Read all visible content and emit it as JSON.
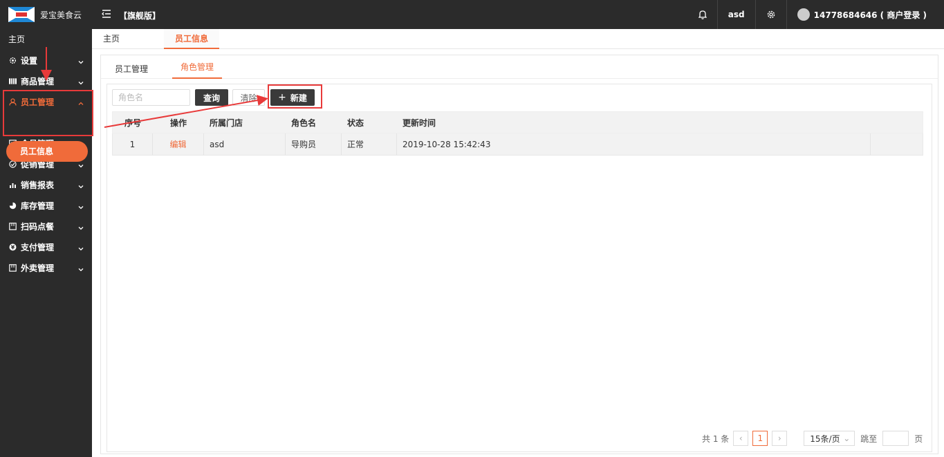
{
  "header": {
    "brand": "爱宝美食云",
    "edition": "【旗舰版】",
    "username": "asd",
    "account": "14778684646 ( 商户登录 )"
  },
  "sidebar": {
    "home": "主页",
    "items": [
      {
        "label": "设置",
        "icon": "gear-icon"
      },
      {
        "label": "商品管理",
        "icon": "barcode-icon"
      },
      {
        "label": "员工管理",
        "icon": "user-icon"
      },
      {
        "label": "会员管理",
        "icon": "member-card-icon"
      },
      {
        "label": "促销管理",
        "icon": "check-circle-icon"
      },
      {
        "label": "销售报表",
        "icon": "bar-chart-icon"
      },
      {
        "label": "库存管理",
        "icon": "pie-chart-icon"
      },
      {
        "label": "扫码点餐",
        "icon": "store-icon"
      },
      {
        "label": "支付管理",
        "icon": "yuan-coin-icon"
      },
      {
        "label": "外卖管理",
        "icon": "store-icon"
      }
    ],
    "active_sub": "员工信息"
  },
  "top_tabs": {
    "home": "主页",
    "active": "员工信息"
  },
  "sub_tabs": {
    "staff": "员工管理",
    "roles": "角色管理"
  },
  "toolbar": {
    "search_placeholder": "角色名",
    "query_label": "查询",
    "clear_label": "清除",
    "new_label": "新建"
  },
  "table": {
    "headers": [
      "序号",
      "操作",
      "所属门店",
      "角色名",
      "状态",
      "更新时间"
    ],
    "rows": [
      {
        "index": "1",
        "action": "编辑",
        "store": "asd",
        "role": "导购员",
        "status": "正常",
        "updated": "2019-10-28 15:42:43"
      }
    ]
  },
  "pager": {
    "total": "共 1 条",
    "current": "1",
    "page_size": "15条/页",
    "jump_label": "跳至",
    "page_unit": "页"
  },
  "colors": {
    "accent": "#f06b3a",
    "dark": "#2b2b2b",
    "highlight": "#e83a3a"
  }
}
